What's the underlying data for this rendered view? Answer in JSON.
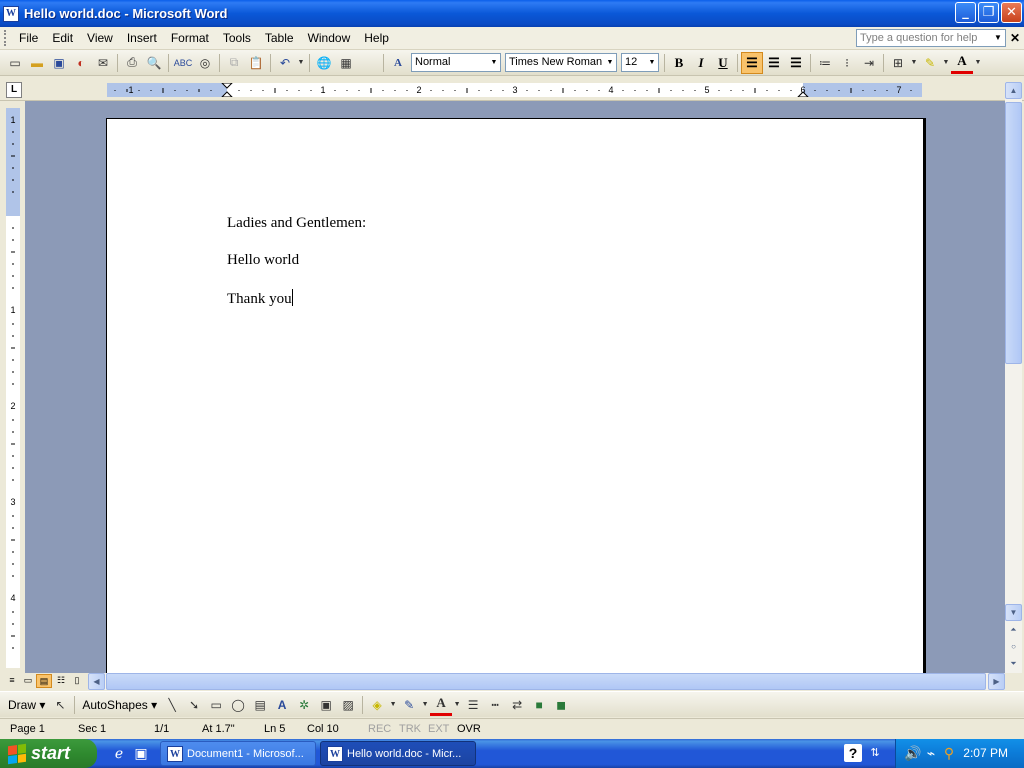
{
  "window": {
    "title": "Hello world.doc - Microsoft Word",
    "app_icon": "W"
  },
  "menu": {
    "items": [
      "File",
      "Edit",
      "View",
      "Insert",
      "Format",
      "Tools",
      "Table",
      "Window",
      "Help"
    ],
    "underline": [
      "F",
      "E",
      "V",
      "I",
      "o",
      "T",
      "a",
      "W",
      "H"
    ],
    "help_placeholder": "Type a question for help"
  },
  "toolbar": {
    "style": "Normal",
    "font": "Times New Roman",
    "size": "12",
    "bold": "B",
    "italic": "I",
    "underline": "U"
  },
  "ruler": {
    "tab_selector": "L",
    "h_numbers": [
      "1",
      "1",
      "2",
      "3",
      "4",
      "5",
      "6",
      "7"
    ],
    "v_numbers": [
      "1",
      "1",
      "2",
      "3",
      "4"
    ]
  },
  "document": {
    "paragraphs": [
      "Ladies and Gentlemen:",
      "Hello world",
      "Thank you"
    ]
  },
  "drawing_toolbar": {
    "draw_label": "Draw",
    "autoshapes_label": "AutoShapes"
  },
  "status": {
    "page": "Page 1",
    "sec": "Sec 1",
    "pages": "1/1",
    "at": "At 1.7\"",
    "ln": "Ln 5",
    "col": "Col 10",
    "rec": "REC",
    "trk": "TRK",
    "ext": "EXT",
    "ovr": "OVR"
  },
  "taskbar": {
    "start_label": "start",
    "tasks": [
      {
        "label": "Document1 - Microsof...",
        "active": false
      },
      {
        "label": "Hello world.doc - Micr...",
        "active": true
      }
    ],
    "clock": "2:07 PM"
  },
  "colors": {
    "title_bar": "#0A58D8",
    "doc_background": "#8C9AB7",
    "taskbar": "#2157D7",
    "start_button": "#2F8A2F",
    "tray": "#0C7BD8"
  }
}
